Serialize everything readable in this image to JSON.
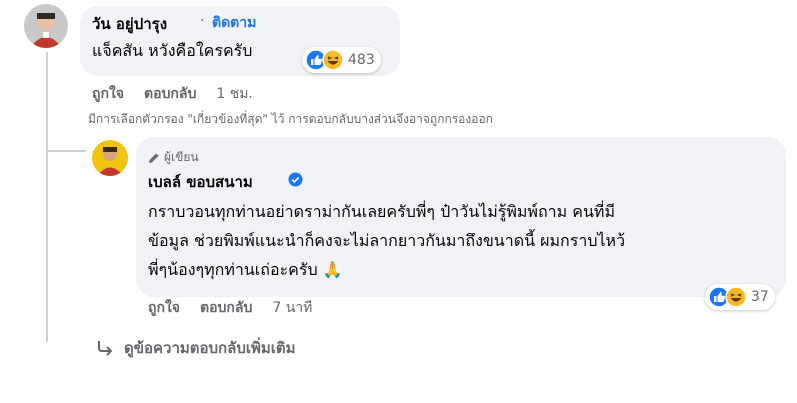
{
  "comment": {
    "author": "วัน อยู่ปารุง",
    "separator": "·",
    "follow_label": "ติดตาม",
    "text": "แจ็คสัน หวังคือใครครับ",
    "reaction_icons": [
      "like-icon",
      "haha-icon"
    ],
    "reaction_count": "483",
    "actions": {
      "like": "ถูกใจ",
      "reply": "ตอบกลับ",
      "time": "1 ชม."
    }
  },
  "filter_note": "มีการเลือกตัวกรอง \"เกี่ยวข้องที่สุด\" ไว้ การตอบกลับบางส่วนจึงอาจถูกกรองออก",
  "reply": {
    "badge": "ผู้เขียน",
    "author": "เบลล์ ขอบสนาม",
    "verified": true,
    "text_lines": [
      "กราบวอนทุกท่านอย่าดราม่ากันเลยครับพี่ๆ ป๋าวันไม่รู้พิมพ์ถาม คนที่มี",
      "ข้อมูล ช่วยพิมพ์แนะนำก็คงจะไม่ลากยาวกันมาถึงขนาดนี้ ผมกราบไหว้",
      "พี่ๆน้องๆทุกท่านเถ่อะครับ 🙏"
    ],
    "reaction_icons": [
      "like-icon",
      "haha-icon"
    ],
    "reaction_count": "37",
    "actions": {
      "like": "ถูกใจ",
      "reply": "ตอบกลับ",
      "time": "7 นาที"
    }
  },
  "view_more_replies": "ดูข้อความตอบกลับเพิ่มเติม",
  "colors": {
    "link_blue": "#1b74e4",
    "bubble_gray": "#f0f2f5",
    "meta_gray": "#65676b"
  }
}
